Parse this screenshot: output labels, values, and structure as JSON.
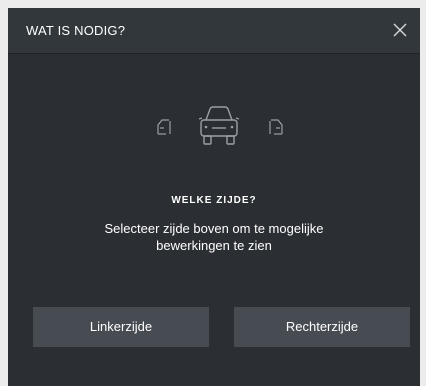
{
  "dialog": {
    "title": "WAT IS NODIG?",
    "close_icon": "close-icon",
    "icons": [
      "left-side-door-icon",
      "car-front-icon",
      "right-side-door-icon"
    ],
    "question": "WELKE ZIJDE?",
    "description": "Selecteer zijde boven om te mogelijke bewerkingen te zien",
    "buttons": {
      "left": "Linkerzijde",
      "right": "Rechterzijde"
    }
  }
}
